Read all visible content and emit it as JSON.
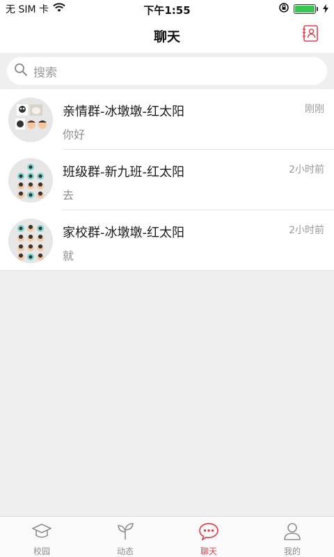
{
  "status_bar": {
    "carrier": "无 SIM 卡",
    "time": "下午1:55"
  },
  "header": {
    "title": "聊天"
  },
  "search": {
    "placeholder": "搜索"
  },
  "chats": [
    {
      "name": "亲情群-冰墩墩-红太阳",
      "preview": "你好",
      "time": "刚刚"
    },
    {
      "name": "班级群-新九班-红太阳",
      "preview": "去",
      "time": "2小时前"
    },
    {
      "name": "家校群-冰墩墩-红太阳",
      "preview": "就",
      "time": "2小时前"
    }
  ],
  "tabs": [
    {
      "label": "校园",
      "icon": "graduation-cap-icon"
    },
    {
      "label": "动态",
      "icon": "sprout-icon"
    },
    {
      "label": "聊天",
      "icon": "chat-bubble-icon",
      "active": true
    },
    {
      "label": "我的",
      "icon": "person-icon"
    }
  ],
  "colors": {
    "accent": "#e0434f",
    "background": "#efefef",
    "battery": "#39c552"
  }
}
